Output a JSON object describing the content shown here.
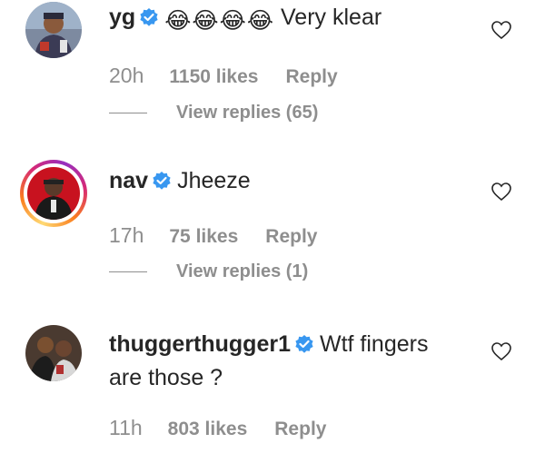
{
  "comments": [
    {
      "username": "yg",
      "verified": true,
      "emoji": [
        "😂",
        "😂",
        "😂",
        "😂"
      ],
      "text": "Very klear",
      "time": "20h",
      "likes": "1150 likes",
      "reply": "Reply",
      "view_replies": "View replies (65)"
    },
    {
      "username": "nav",
      "verified": true,
      "text": "Jheeze",
      "time": "17h",
      "likes": "75 likes",
      "reply": "Reply",
      "view_replies": "View replies (1)"
    },
    {
      "username": "thuggerthugger1",
      "verified": true,
      "text": "Wtf fingers are those ?",
      "time": "11h",
      "likes": "803 likes",
      "reply": "Reply"
    }
  ],
  "icons": {
    "verified": "verified-badge-icon",
    "heart": "heart-outline-icon"
  },
  "colors": {
    "verified_blue": "#3897f0",
    "meta_gray": "#8e8e8e",
    "text": "#262626"
  }
}
